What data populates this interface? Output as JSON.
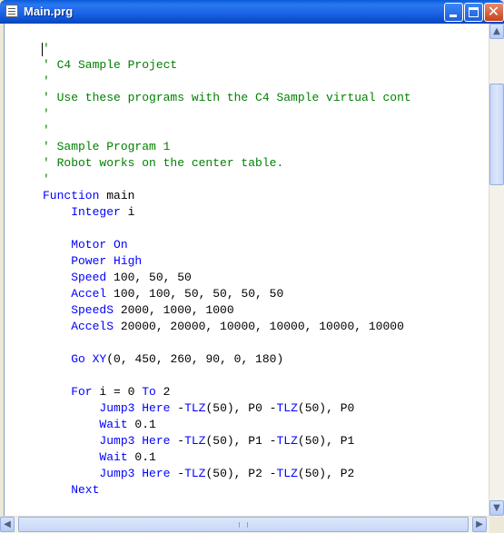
{
  "window": {
    "title": "Main.prg"
  },
  "titlebar_buttons": {
    "minimize": "minimize",
    "maximize": "maximize",
    "close": "✕"
  },
  "colors": {
    "comment": "#008000",
    "keyword": "#0000ff",
    "text": "#000000",
    "titlebar": "#0a5bd8"
  },
  "code": {
    "lines": [
      [
        {
          "t": "'",
          "c": "comment"
        }
      ],
      [
        {
          "t": "' C4 Sample Project",
          "c": "comment"
        }
      ],
      [
        {
          "t": "'",
          "c": "comment"
        }
      ],
      [
        {
          "t": "' Use these programs with the C4 Sample virtual cont",
          "c": "comment"
        }
      ],
      [
        {
          "t": "'",
          "c": "comment"
        }
      ],
      [
        {
          "t": "'",
          "c": "comment"
        }
      ],
      [
        {
          "t": "' Sample Program 1",
          "c": "comment"
        }
      ],
      [
        {
          "t": "' Robot works on the center table.",
          "c": "comment"
        }
      ],
      [
        {
          "t": "'",
          "c": "comment"
        }
      ],
      [
        {
          "t": "Function",
          "c": "key"
        },
        {
          "t": " main",
          "c": "text"
        }
      ],
      [
        {
          "t": "    Integer",
          "c": "key"
        },
        {
          "t": " i",
          "c": "text"
        }
      ],
      [],
      [
        {
          "t": "    Motor",
          "c": "key"
        },
        {
          "t": " ",
          "c": "text"
        },
        {
          "t": "On",
          "c": "key"
        }
      ],
      [
        {
          "t": "    Power",
          "c": "key"
        },
        {
          "t": " ",
          "c": "text"
        },
        {
          "t": "High",
          "c": "key"
        }
      ],
      [
        {
          "t": "    Speed",
          "c": "key"
        },
        {
          "t": " 100, 50, 50",
          "c": "text"
        }
      ],
      [
        {
          "t": "    Accel",
          "c": "key"
        },
        {
          "t": " 100, 100, 50, 50, 50, 50",
          "c": "text"
        }
      ],
      [
        {
          "t": "    SpeedS",
          "c": "key"
        },
        {
          "t": " 2000, 1000, 1000",
          "c": "text"
        }
      ],
      [
        {
          "t": "    AccelS",
          "c": "key"
        },
        {
          "t": " 20000, 20000, 10000, 10000, 10000, 10000",
          "c": "text"
        }
      ],
      [],
      [
        {
          "t": "    Go",
          "c": "key"
        },
        {
          "t": " ",
          "c": "text"
        },
        {
          "t": "XY",
          "c": "key"
        },
        {
          "t": "(0, 450, 260, 90, 0, 180)",
          "c": "text"
        }
      ],
      [],
      [
        {
          "t": "    For",
          "c": "key"
        },
        {
          "t": " i = 0 ",
          "c": "text"
        },
        {
          "t": "To",
          "c": "key"
        },
        {
          "t": " 2",
          "c": "text"
        }
      ],
      [
        {
          "t": "        Jump3",
          "c": "key"
        },
        {
          "t": " ",
          "c": "text"
        },
        {
          "t": "Here",
          "c": "key"
        },
        {
          "t": " -",
          "c": "text"
        },
        {
          "t": "TLZ",
          "c": "key"
        },
        {
          "t": "(50), P0 -",
          "c": "text"
        },
        {
          "t": "TLZ",
          "c": "key"
        },
        {
          "t": "(50), P0",
          "c": "text"
        }
      ],
      [
        {
          "t": "        Wait",
          "c": "key"
        },
        {
          "t": " 0.1",
          "c": "text"
        }
      ],
      [
        {
          "t": "        Jump3",
          "c": "key"
        },
        {
          "t": " ",
          "c": "text"
        },
        {
          "t": "Here",
          "c": "key"
        },
        {
          "t": " -",
          "c": "text"
        },
        {
          "t": "TLZ",
          "c": "key"
        },
        {
          "t": "(50), P1 -",
          "c": "text"
        },
        {
          "t": "TLZ",
          "c": "key"
        },
        {
          "t": "(50), P1",
          "c": "text"
        }
      ],
      [
        {
          "t": "        Wait",
          "c": "key"
        },
        {
          "t": " 0.1",
          "c": "text"
        }
      ],
      [
        {
          "t": "        Jump3",
          "c": "key"
        },
        {
          "t": " ",
          "c": "text"
        },
        {
          "t": "Here",
          "c": "key"
        },
        {
          "t": " -",
          "c": "text"
        },
        {
          "t": "TLZ",
          "c": "key"
        },
        {
          "t": "(50), P2 -",
          "c": "text"
        },
        {
          "t": "TLZ",
          "c": "key"
        },
        {
          "t": "(50), P2",
          "c": "text"
        }
      ],
      [
        {
          "t": "    Next",
          "c": "key"
        }
      ]
    ]
  },
  "scrollbar": {
    "up_arrow": "▲",
    "down_arrow": "▼",
    "left_arrow": "◀",
    "right_arrow": "▶"
  }
}
